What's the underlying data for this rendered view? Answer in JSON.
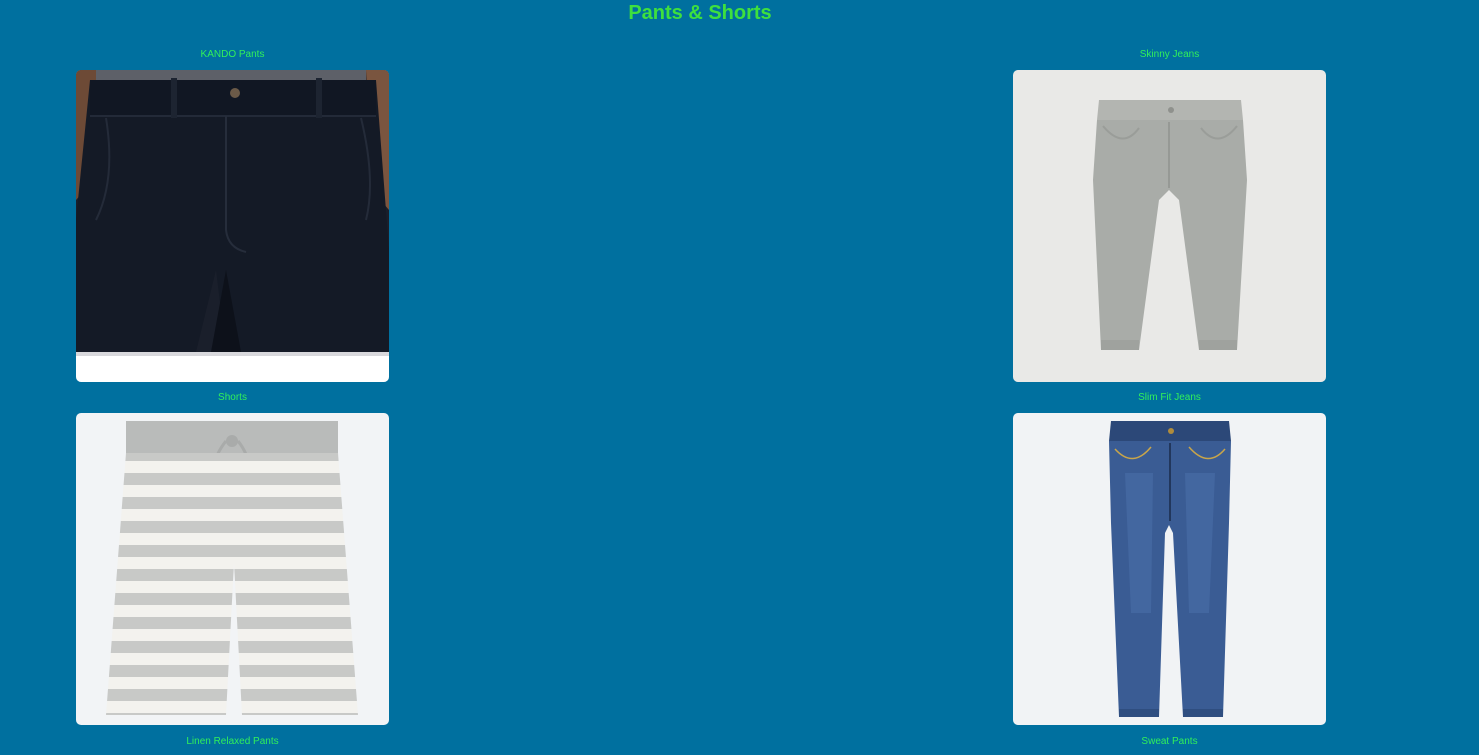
{
  "page": {
    "title": "Pants & Shorts"
  },
  "products": [
    {
      "name": "KANDO Pants",
      "image": "navy-trousers-photo"
    },
    {
      "name": "Skinny Jeans",
      "image": "grey-skinny-jeans-photo"
    },
    {
      "name": "Shorts",
      "image": "striped-shorts-photo"
    },
    {
      "name": "Slim Fit Jeans",
      "image": "blue-slim-jeans-photo"
    },
    {
      "name": "Linen Relaxed Pants"
    },
    {
      "name": "Sweat Pants"
    }
  ],
  "colors": {
    "background": "#00709f",
    "title": "#3ee03e",
    "label": "#31f05a"
  }
}
